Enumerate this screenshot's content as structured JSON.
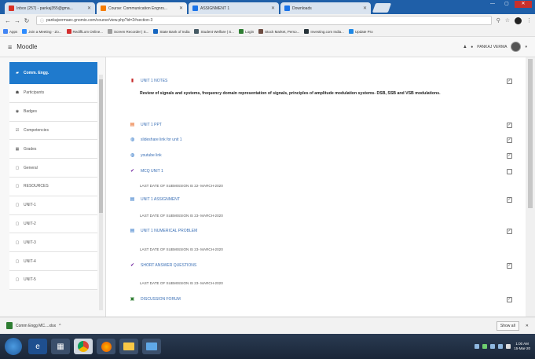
{
  "browser": {
    "tabs": [
      {
        "title": "Inbox (257) - pankaj355@gma...",
        "color": "#d93025",
        "active": false
      },
      {
        "title": "Course: Communication Engnrs...",
        "color": "#f57c00",
        "active": true
      },
      {
        "title": "ASSIGNMENT 1",
        "color": "#1a73e8",
        "active": false
      },
      {
        "title": "Downloads",
        "color": "#1a73e8",
        "active": false
      }
    ],
    "url": "pankajvermaec.gnomio.com/course/view.php?id=2#section-3",
    "bookmarks": [
      {
        "label": "Apps",
        "color": "#4285f4"
      },
      {
        "label": "Join a Meeting - Zo...",
        "color": "#2d8cff"
      },
      {
        "label": "RediffLom Online...",
        "color": "#d32f2f"
      },
      {
        "label": "Screen Recorder | S...",
        "color": "#9e9e9e"
      },
      {
        "label": "State Bank of India",
        "color": "#1565c0"
      },
      {
        "label": "Student Welfare | S...",
        "color": "#455a64"
      },
      {
        "label": "Login",
        "color": "#2e7d32"
      },
      {
        "label": "Stock Market, Perso...",
        "color": "#6d4c41"
      },
      {
        "label": "Investing.com India...",
        "color": "#263238"
      },
      {
        "label": "Update Pro",
        "color": "#1e88e5"
      }
    ]
  },
  "moodle": {
    "brand": "Moodle",
    "username": "PANKAJ VERMA"
  },
  "sidebar": {
    "items": [
      {
        "label": "Comm. Engg.",
        "icon": "▰",
        "active": true
      },
      {
        "label": "Participants",
        "icon": "☗",
        "active": false
      },
      {
        "label": "Badges",
        "icon": "◉",
        "active": false
      },
      {
        "label": "Competencies",
        "icon": "☑",
        "active": false
      },
      {
        "label": "Grades",
        "icon": "▦",
        "active": false
      },
      {
        "label": "General",
        "icon": "▢",
        "active": false
      },
      {
        "label": "RESOURCES",
        "icon": "▢",
        "active": false
      },
      {
        "label": "UNIT-1",
        "icon": "▢",
        "active": false
      },
      {
        "label": "UNIT-2",
        "icon": "▢",
        "active": false
      },
      {
        "label": "UNIT-3",
        "icon": "▢",
        "active": false
      },
      {
        "label": "UNIT-4",
        "icon": "▢",
        "active": false
      },
      {
        "label": "UNIT-5",
        "icon": "▢",
        "active": false
      }
    ]
  },
  "main": {
    "unit_notes": "UNIT 1 NOTES",
    "summary": "Review of signals and systems, frequency domain representation of signals, principles of amplitude modulation systems- DSB, SSB and VSB modulations.",
    "activities": [
      {
        "label": "UNIT 1 PPT",
        "icon": "ppt-icon",
        "glyph": "▤",
        "color": "#e65100",
        "checked": true
      },
      {
        "label": "slideshare link for unit 1",
        "icon": "url-icon",
        "glyph": "◍",
        "color": "#1565c0",
        "checked": true
      },
      {
        "label": "youtube link",
        "icon": "url-icon",
        "glyph": "◍",
        "color": "#1565c0",
        "checked": true
      },
      {
        "label": "MCQ UNIT 1",
        "icon": "quiz-icon",
        "glyph": "✔",
        "color": "#6a1b9a",
        "checked": false
      }
    ],
    "mcq_note": "LAST DATE OF SUBMISSION IS 22- MARCH-2020",
    "assignment": "UNIT 1 ASSIGNMENT",
    "assignment_note": "LAST DATE OF SUBMISSION IS 23- MARCH-2020",
    "numerical": "UNIT 1 NUMERICAL PROBLEM",
    "numerical_note": "LAST DATE OF SUBMISSION IS 23- MARCH-2020",
    "short_answer": "SHORT ANSWER QUESTIONS",
    "short_note": "LAST DATE OF SUBMISSION IS 23- MARCH-2020",
    "forum": "DISCUSSION FORUM"
  },
  "downloads": {
    "file": "Comm Engg MC....xlsx",
    "show_all": "Show all"
  },
  "taskbar": {
    "time": "1:00 AM",
    "date": "15-Mar-20"
  }
}
